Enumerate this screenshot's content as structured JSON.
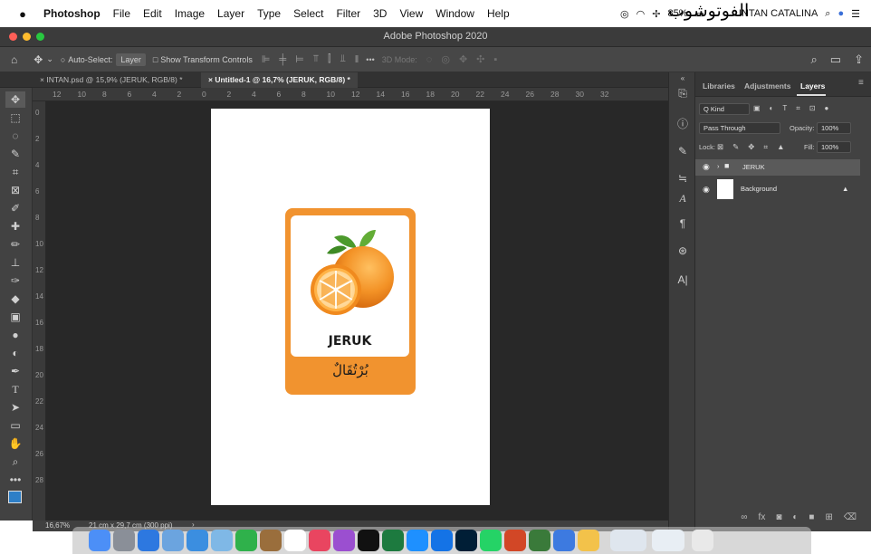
{
  "menubar": {
    "app_name": "Photoshop",
    "items": [
      "File",
      "Edit",
      "Image",
      "Layer",
      "Type",
      "Select",
      "Filter",
      "3D",
      "View",
      "Window",
      "Help"
    ],
    "battery": "85%",
    "user": "INTAN CATALINA",
    "overlay_text": "الفوتوشوب"
  },
  "window": {
    "title": "Adobe Photoshop 2020"
  },
  "options_bar": {
    "auto_select_label": "Auto-Select:",
    "auto_select_value": "Layer",
    "show_transform_label": "Show Transform Controls",
    "mode_3d_label": "3D Mode:",
    "more_label": "•••"
  },
  "tabs": [
    {
      "label": "INTAN.psd @ 15,9% (JERUK, RGB/8) *"
    },
    {
      "label": "Untitled-1 @ 16,7% (JERUK, RGB/8) *"
    }
  ],
  "ruler": {
    "h_ticks": [
      "12",
      "10",
      "8",
      "6",
      "4",
      "2",
      "0",
      "2",
      "4",
      "6",
      "8",
      "10",
      "12",
      "14",
      "16",
      "18",
      "20",
      "22",
      "24",
      "26",
      "28",
      "30",
      "32"
    ],
    "v_ticks": [
      "0",
      "2",
      "4",
      "6",
      "8",
      "10",
      "12",
      "14",
      "16",
      "18",
      "20",
      "22",
      "24",
      "26",
      "28"
    ]
  },
  "canvas": {
    "card_word": "JERUK",
    "card_arabic": "بُرْتُقَالٌ",
    "card_color": "#f1932f"
  },
  "status": {
    "zoom": "16,67%",
    "doc_size": "21 cm x 29,7 cm (300 ppi)"
  },
  "panel": {
    "tabs": [
      "Libraries",
      "Adjustments",
      "Layers"
    ],
    "active_tab": "Layers",
    "kind_label": "Q Kind",
    "blend_mode": "Pass Through",
    "opacity_label": "Opacity:",
    "opacity_value": "100%",
    "lock_label": "Lock:",
    "fill_label": "Fill:",
    "fill_value": "100%",
    "layers": [
      {
        "name": "JERUK",
        "type": "group",
        "selected": true
      },
      {
        "name": "Background",
        "type": "image",
        "selected": false,
        "locked": true
      }
    ]
  }
}
